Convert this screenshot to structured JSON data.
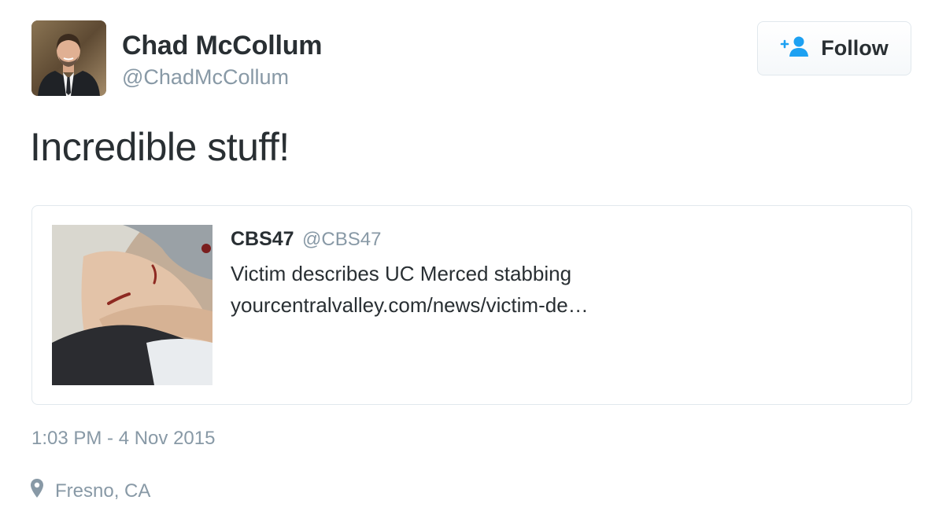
{
  "author": {
    "display_name": "Chad McCollum",
    "screen_name": "@ChadMcCollum",
    "avatar_icon": "profile-photo"
  },
  "follow_button": {
    "label": "Follow",
    "icon": "add-user-icon",
    "icon_color": "#1da1f2"
  },
  "tweet": {
    "text": "Incredible stuff!",
    "timestamp": "1:03 PM - 4 Nov 2015",
    "location": "Fresno, CA",
    "location_icon": "map-pin-icon"
  },
  "quoted_tweet": {
    "name": "CBS47",
    "handle": "@CBS47",
    "text": "Victim describes UC Merced stabbing",
    "link": "yourcentralvalley.com/news/victim-de…"
  },
  "colors": {
    "text": "#292f33",
    "secondary": "#8899a6",
    "border": "#e1e8ed",
    "accent": "#1da1f2"
  }
}
